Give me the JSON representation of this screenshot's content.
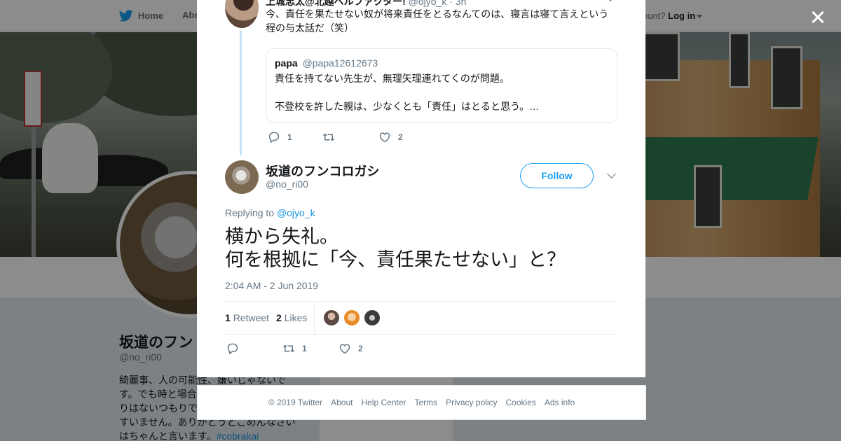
{
  "nav": {
    "home": "Home",
    "about": "About",
    "account_prompt": "ccount?",
    "login": "Log in"
  },
  "profile": {
    "name": "坂道のフン",
    "handle": "@no_ri00",
    "bio": [
      "綺麗事、人の可能性、嫌いじゃないで",
      "す。でも時と場合",
      "りはないつもりで",
      "すいません。ありがとうとごめんなさい",
      "はちゃんと言います。"
    ],
    "bio_hashtag": "#cobrakai",
    "bg_card_text": "Ads info"
  },
  "parent_tweet": {
    "author": "上城忠太@北越ベルファクター!",
    "handle": "@ojyo_k",
    "time": "· 3h",
    "lines": [
      "今、責任を果たせない奴が将来責任をとるなんてのは、寝言は寝て言えという",
      "程の与太話だ（笑）"
    ],
    "quote": {
      "name": "papa",
      "handle": "@papa12612673",
      "line1": "責任を持てない先生が、無理矢理連れてくのが問題。",
      "line2": "不登校を許した親は、少なくとも「責任」はとると思う。…"
    },
    "replies": "1",
    "retweets": "",
    "likes": "2"
  },
  "tweet": {
    "author": "坂道のフンコロガシ",
    "handle": "@no_ri00",
    "follow_label": "Follow",
    "replying_prefix": "Replying to",
    "replying_to": "@ojyo_k",
    "text_lines": [
      "横から失礼。",
      "何を根拠に「今、責任果たせない」と？"
    ],
    "timestamp": "2:04 AM - 2 Jun 2019",
    "retweet_count": "1",
    "retweet_label": "Retweet",
    "like_count": "2",
    "like_label": "Likes",
    "action_retweets": "1",
    "action_likes": "2"
  },
  "footer": {
    "links": [
      "© 2019 Twitter",
      "About",
      "Help Center",
      "Terms",
      "Privacy policy",
      "Cookies",
      "Ads info"
    ]
  },
  "colors": {
    "accent": "#1da1f2",
    "link": "#1b95e0",
    "muted": "#657786",
    "thread_line": "#c4e4f7"
  }
}
